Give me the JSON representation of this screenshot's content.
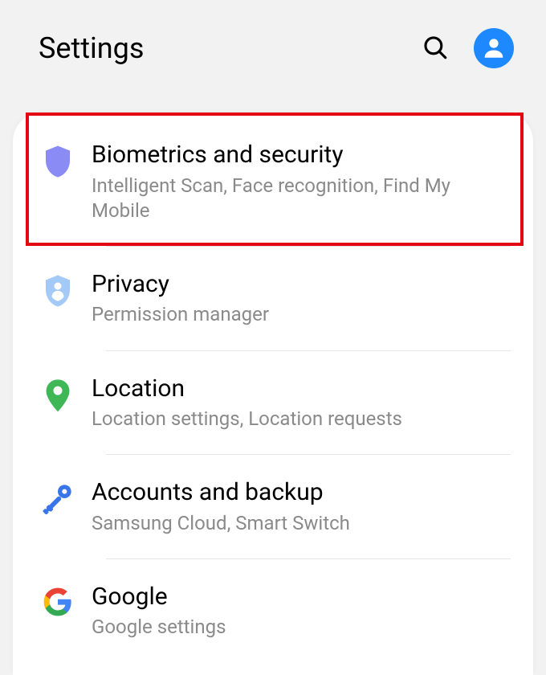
{
  "header": {
    "title": "Settings"
  },
  "rows": [
    {
      "title": "Biometrics and security",
      "subtitle": "Intelligent Scan, Face recognition, Find My Mobile"
    },
    {
      "title": "Privacy",
      "subtitle": "Permission manager"
    },
    {
      "title": "Location",
      "subtitle": "Location settings, Location requests"
    },
    {
      "title": "Accounts and backup",
      "subtitle": "Samsung Cloud, Smart Switch"
    },
    {
      "title": "Google",
      "subtitle": "Google settings"
    }
  ]
}
